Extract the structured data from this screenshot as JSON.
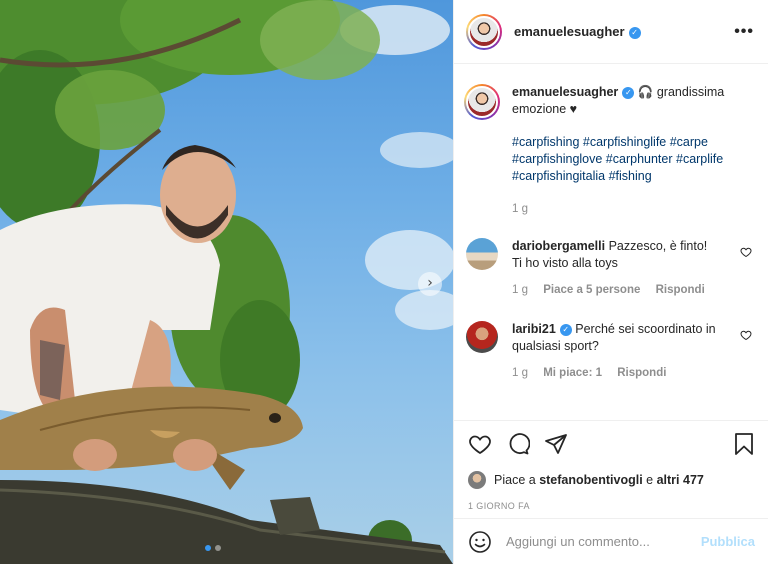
{
  "post": {
    "username": "emanuelesuagher",
    "verified": true,
    "caption_emoji": "🎧",
    "caption_text": "grandissima emozione ♥",
    "hashtags": "#carpfishing #carpfishinglife #carpe #carpfishinglove #carphunter #carplife #carpfishingitalia #fishing",
    "caption_age": "1 g",
    "photo_count": 2,
    "current_photo": 1
  },
  "comments": [
    {
      "username": "dariobergamelli",
      "verified": false,
      "text": "Pazzesco, è finto!\nTi ho visto alla toys",
      "age": "1 g",
      "likes_label": "Piace a 5 persone",
      "reply_label": "Rispondi"
    },
    {
      "username": "laribi21",
      "verified": true,
      "text": "Perché sei scoordinato in qualsiasi sport?",
      "age": "1 g",
      "likes_label": "Mi piace: 1",
      "reply_label": "Rispondi"
    }
  ],
  "likes": {
    "prefix": "Piace a",
    "user": "stefanobentivogli",
    "connector": "e",
    "others": "altri 477"
  },
  "timestamp": "1 GIORNO FA",
  "add_comment": {
    "placeholder": "Aggiungi un commento...",
    "publish_label": "Pubblica"
  },
  "icons": {
    "more": "more-options-icon",
    "like": "heart-icon",
    "comment": "comment-icon",
    "share": "share-icon",
    "save": "bookmark-icon",
    "emoji": "emoji-icon",
    "next": "chevron-right-icon"
  },
  "colors": {
    "verified": "#3897f0",
    "hashtag": "#00376b",
    "muted": "#8e8e8e",
    "publish": "#b2dffc"
  }
}
